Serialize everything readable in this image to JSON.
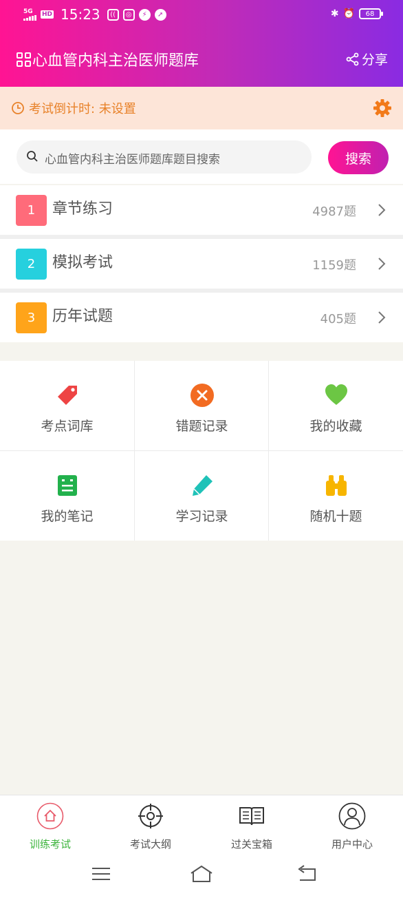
{
  "status": {
    "network": "5G",
    "hd": "HD",
    "time": "15:23",
    "battery": "68"
  },
  "header": {
    "title": "心血管内科主治医师题库",
    "share_label": "分享"
  },
  "countdown": {
    "label": "考试倒计时: 未设置"
  },
  "search": {
    "placeholder": "心血管内科主治医师题库题目搜索",
    "button": "搜索"
  },
  "sections": [
    {
      "num": "1",
      "label": "章节练习",
      "count": "4987题",
      "color": "#ff6b7a"
    },
    {
      "num": "2",
      "label": "模拟考试",
      "count": "1159题",
      "color": "#26d0de"
    },
    {
      "num": "3",
      "label": "历年试题",
      "count": "405题",
      "color": "#ffa41a"
    }
  ],
  "tools": [
    {
      "label": "考点词库",
      "icon": "tag-icon",
      "color": "#ee4444"
    },
    {
      "label": "错题记录",
      "icon": "close-circle-icon",
      "color": "#f26b22"
    },
    {
      "label": "我的收藏",
      "icon": "heart-icon",
      "color": "#6cc644"
    },
    {
      "label": "我的笔记",
      "icon": "note-icon",
      "color": "#22b14c"
    },
    {
      "label": "学习记录",
      "icon": "pencil-icon",
      "color": "#1fc2b8"
    },
    {
      "label": "随机十题",
      "icon": "binoculars-icon",
      "color": "#f7b500"
    }
  ],
  "tabs": [
    {
      "label": "训练考试",
      "icon": "home-icon",
      "active": true
    },
    {
      "label": "考试大纲",
      "icon": "target-icon"
    },
    {
      "label": "过关宝箱",
      "icon": "book-icon"
    },
    {
      "label": "用户中心",
      "icon": "user-icon"
    }
  ],
  "colors": {
    "brand_start": "#ff1493",
    "brand_end": "#8a2be2",
    "accent_orange": "#e8822a",
    "active_tab": "#3cb43c"
  }
}
